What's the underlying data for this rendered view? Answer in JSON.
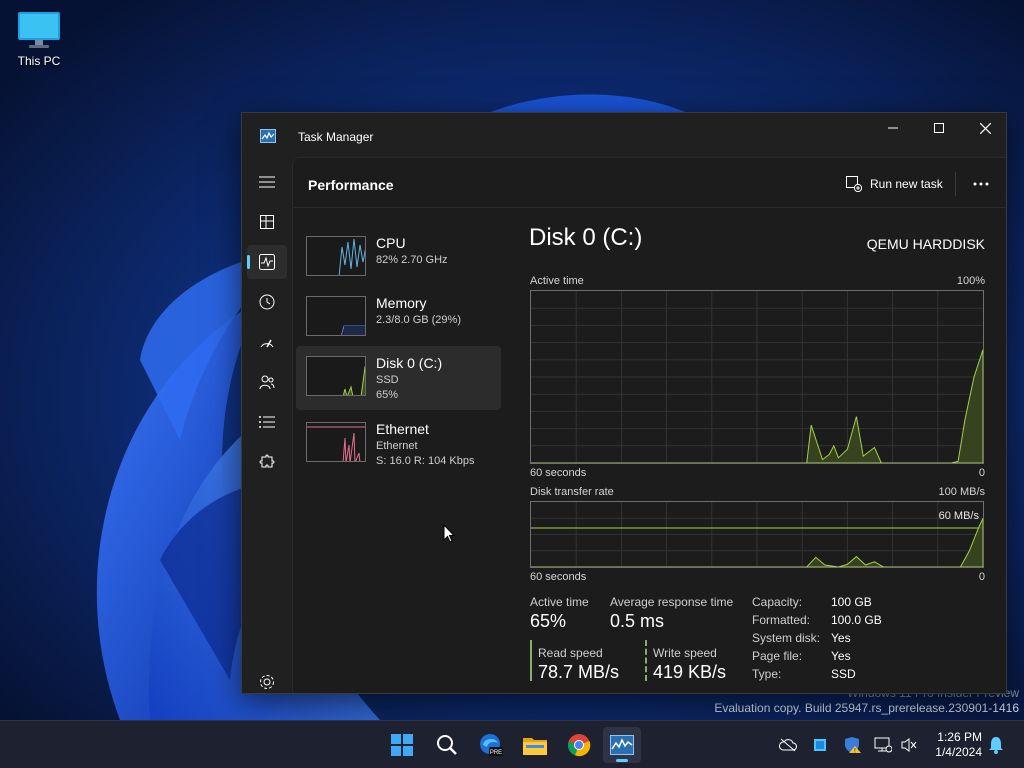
{
  "desktop": {
    "icon_label": "This PC",
    "watermark_line1": "Windows 11 Pro Insider Preview",
    "watermark_line2": "Evaluation copy. Build 25947.rs_prerelease.230901-1416"
  },
  "window": {
    "title": "Task Manager"
  },
  "nav": {
    "items": [
      "menu-icon",
      "processes-icon",
      "performance-icon",
      "app-history-icon",
      "startup-apps-icon",
      "users-icon",
      "details-icon",
      "services-icon",
      "settings-icon"
    ],
    "active": "performance-icon"
  },
  "header": {
    "page_title": "Performance",
    "run_new_task": "Run new task"
  },
  "resources": [
    {
      "name": "CPU",
      "sub1": "82%  2.70 GHz",
      "sub2": ""
    },
    {
      "name": "Memory",
      "sub1": "2.3/8.0 GB (29%)",
      "sub2": ""
    },
    {
      "name": "Disk 0 (C:)",
      "sub1": "SSD",
      "sub2": "65%"
    },
    {
      "name": "Ethernet",
      "sub1": "Ethernet",
      "sub2": "S: 16.0  R: 104 Kbps"
    }
  ],
  "disk": {
    "title": "Disk 0 (C:)",
    "model": "QEMU HARDDISK",
    "active_time_label": "Active time",
    "active_time_max": "100%",
    "graph1_xleft": "60 seconds",
    "graph1_xright": "0",
    "transfer_label": "Disk transfer rate",
    "transfer_max": "100 MB/s",
    "transfer_line_label": "60 MB/s",
    "graph2_xleft": "60 seconds",
    "graph2_xright": "0",
    "stats": {
      "active_time_label": "Active time",
      "active_time_value": "65%",
      "avg_resp_label": "Average response time",
      "avg_resp_value": "0.5 ms",
      "read_label": "Read speed",
      "read_value": "78.7 MB/s",
      "write_label": "Write speed",
      "write_value": "419 KB/s"
    },
    "props": [
      {
        "label": "Capacity:",
        "value": "100 GB"
      },
      {
        "label": "Formatted:",
        "value": "100.0 GB"
      },
      {
        "label": "System disk:",
        "value": "Yes"
      },
      {
        "label": "Page file:",
        "value": "Yes"
      },
      {
        "label": "Type:",
        "value": "SSD"
      }
    ]
  },
  "taskbar": {
    "pinned": [
      "start-icon",
      "search-icon",
      "edge-dev-icon",
      "file-explorer-icon",
      "chrome-icon",
      "task-manager-icon"
    ],
    "time": "1:26 PM",
    "date": "1/4/2024"
  },
  "colors": {
    "accent": "#60cdff",
    "disk_graph": "#a6d04a",
    "cpu_graph": "#60b4e0",
    "memory_graph": "#5e7fe0",
    "ethernet_graph": "#e0708e"
  }
}
